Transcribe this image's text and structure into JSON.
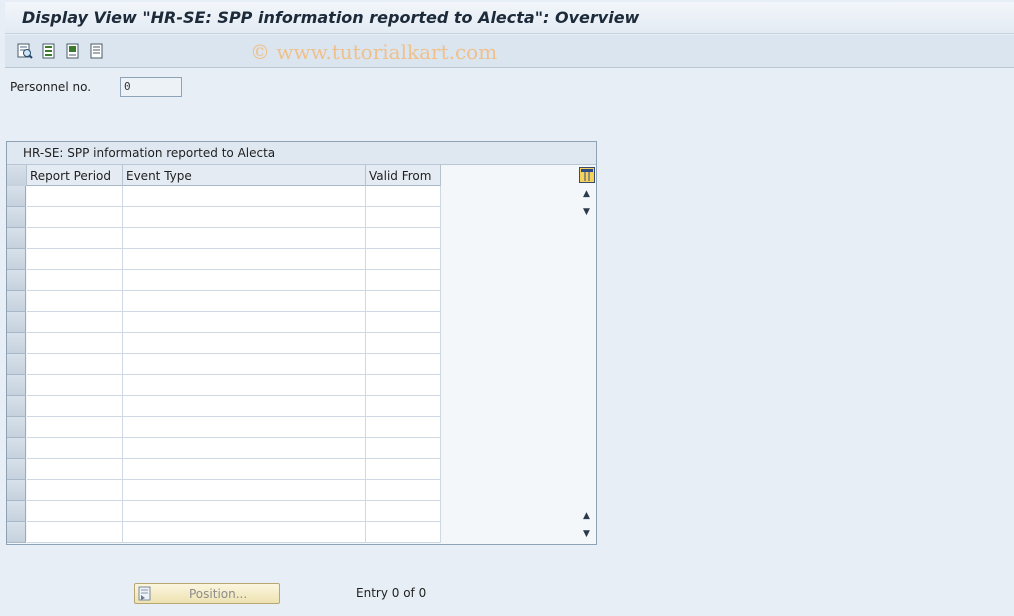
{
  "window": {
    "title": "Display View \"HR-SE: SPP information reported to Alecta\": Overview"
  },
  "toolbar": {
    "buttons": [
      {
        "icon": "details-icon"
      },
      {
        "icon": "select-all-icon"
      },
      {
        "icon": "select-block-icon"
      },
      {
        "icon": "deselect-all-icon"
      }
    ],
    "watermark": "© www.tutorialkart.com"
  },
  "filter": {
    "personnel_label": "Personnel no.",
    "personnel_value": "0"
  },
  "table": {
    "title": "HR-SE: SPP information reported to Alecta",
    "columns": [
      "Report Period",
      "Event Type",
      "Valid From"
    ],
    "row_count": 17,
    "rows": []
  },
  "footer": {
    "position_button": "Position...",
    "entry_text": "Entry 0 of 0"
  },
  "colors": {
    "background": "#e7eef5",
    "button_bg": "#f3eac4"
  }
}
